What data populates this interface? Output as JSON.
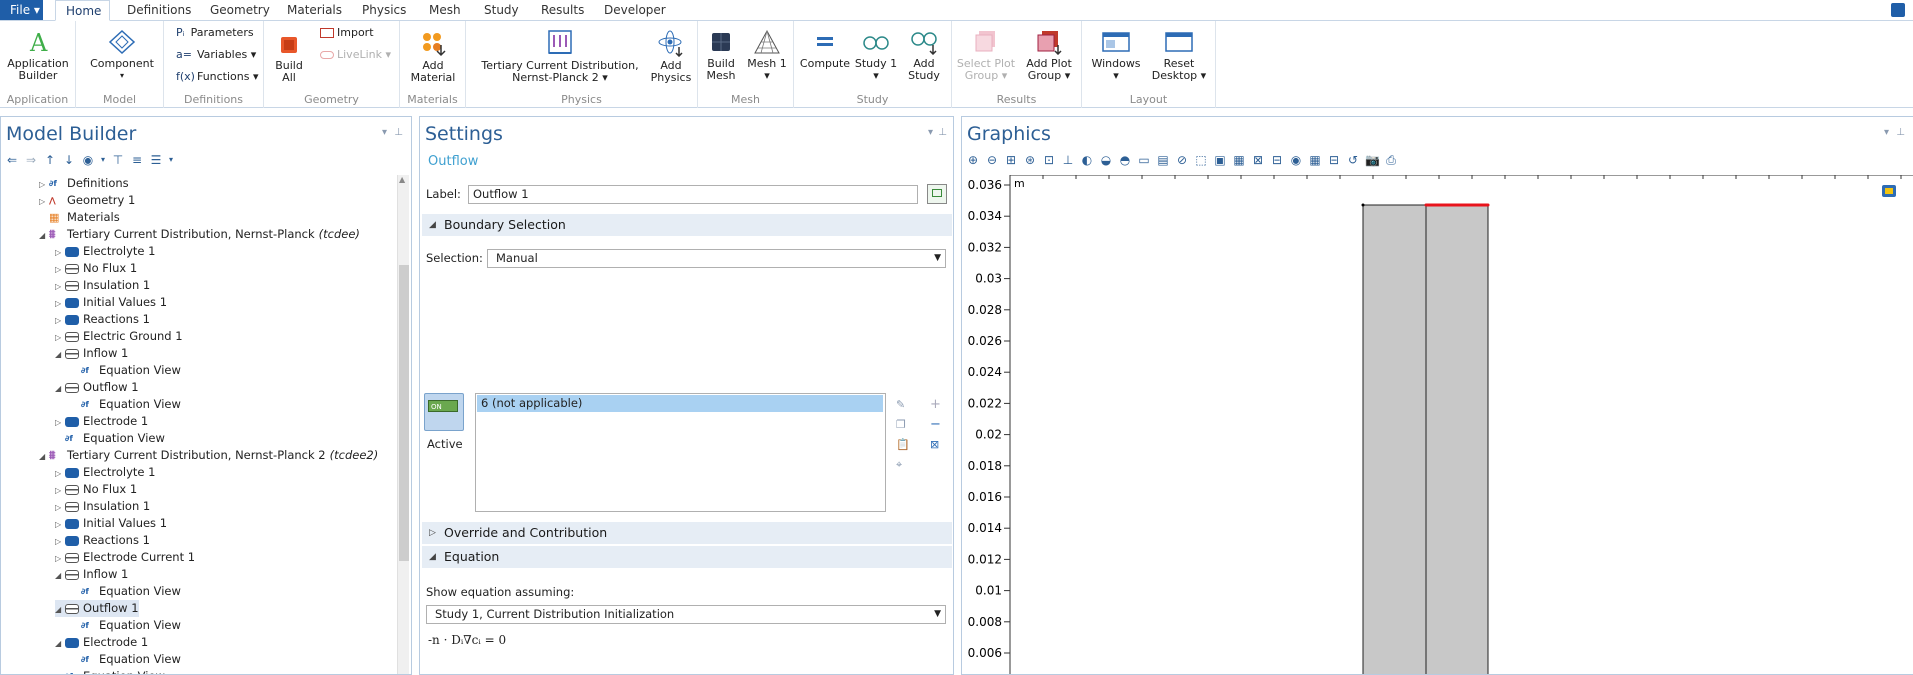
{
  "menubar": {
    "file": "File ▾",
    "tabs": [
      "Home",
      "Definitions",
      "Geometry",
      "Materials",
      "Physics",
      "Mesh",
      "Study",
      "Results",
      "Developer"
    ],
    "active_tab": "Home"
  },
  "ribbon": {
    "groups": {
      "application": "Application",
      "model": "Model",
      "definitions": "Definitions",
      "geometry": "Geometry",
      "materials": "Materials",
      "physics": "Physics",
      "mesh": "Mesh",
      "study": "Study",
      "results": "Results",
      "layout": "Layout"
    },
    "buttons": {
      "app_builder": "Application Builder",
      "component": "Component",
      "parameters": "Parameters",
      "variables": "Variables ▾",
      "functions": "Functions ▾",
      "build_all": "Build All",
      "import": "Import",
      "livelink": "LiveLink ▾",
      "add_material": "Add Material",
      "physics_iface": "Tertiary Current Distribution, Nernst-Planck 2 ▾",
      "add_physics": "Add Physics",
      "build_mesh": "Build Mesh",
      "mesh1": "Mesh 1 ▾",
      "compute": "Compute",
      "study1": "Study 1 ▾",
      "add_study": "Add Study",
      "select_plot_group": "Select Plot Group ▾",
      "add_plot_group": "Add Plot Group ▾",
      "windows": "Windows ▾",
      "reset_desktop": "Reset Desktop ▾"
    },
    "icons": {
      "parameters": "Pᵢ",
      "variables": "a=",
      "functions": "f(x)"
    }
  },
  "model_builder": {
    "title": "Model Builder",
    "tree": [
      {
        "label": "Definitions",
        "indent": 1,
        "arrow": "▷",
        "icon": "eq",
        "bold": false
      },
      {
        "label": "Geometry 1",
        "indent": 1,
        "arrow": "▷",
        "icon": "geom"
      },
      {
        "label": "Materials",
        "indent": 1,
        "arrow": "",
        "icon": "mat"
      },
      {
        "label": "Tertiary Current Distribution, Nernst-Planck",
        "suffix": "(tcdee)",
        "indent": 1,
        "arrow": "◢",
        "icon": "phys"
      },
      {
        "label": "Electrolyte 1",
        "indent": 2,
        "arrow": "▷",
        "icon": "blue"
      },
      {
        "label": "No Flux 1",
        "indent": 2,
        "arrow": "▷",
        "icon": "bound"
      },
      {
        "label": "Insulation 1",
        "indent": 2,
        "arrow": "▷",
        "icon": "bound"
      },
      {
        "label": "Initial Values 1",
        "indent": 2,
        "arrow": "▷",
        "icon": "blue"
      },
      {
        "label": "Reactions 1",
        "indent": 2,
        "arrow": "▷",
        "icon": "blue"
      },
      {
        "label": "Electric Ground 1",
        "indent": 2,
        "arrow": "▷",
        "icon": "bound"
      },
      {
        "label": "Inflow 1",
        "indent": 2,
        "arrow": "◢",
        "icon": "bound"
      },
      {
        "label": "Equation View",
        "indent": 3,
        "arrow": "",
        "icon": "eq"
      },
      {
        "label": "Outflow 1",
        "indent": 2,
        "arrow": "◢",
        "icon": "bound"
      },
      {
        "label": "Equation View",
        "indent": 3,
        "arrow": "",
        "icon": "eq"
      },
      {
        "label": "Electrode 1",
        "indent": 2,
        "arrow": "▷",
        "icon": "blue"
      },
      {
        "label": "Equation View",
        "indent": 2,
        "arrow": "",
        "icon": "eq"
      },
      {
        "label": "Tertiary Current Distribution, Nernst-Planck 2",
        "suffix": "(tcdee2)",
        "indent": 1,
        "arrow": "◢",
        "icon": "phys"
      },
      {
        "label": "Electrolyte 1",
        "indent": 2,
        "arrow": "▷",
        "icon": "blue"
      },
      {
        "label": "No Flux 1",
        "indent": 2,
        "arrow": "▷",
        "icon": "bound"
      },
      {
        "label": "Insulation 1",
        "indent": 2,
        "arrow": "▷",
        "icon": "bound"
      },
      {
        "label": "Initial Values 1",
        "indent": 2,
        "arrow": "▷",
        "icon": "blue"
      },
      {
        "label": "Reactions 1",
        "indent": 2,
        "arrow": "▷",
        "icon": "blue"
      },
      {
        "label": "Electrode Current 1",
        "indent": 2,
        "arrow": "▷",
        "icon": "bound"
      },
      {
        "label": "Inflow 1",
        "indent": 2,
        "arrow": "◢",
        "icon": "bound"
      },
      {
        "label": "Equation View",
        "indent": 3,
        "arrow": "",
        "icon": "eq"
      },
      {
        "label": "Outflow 1",
        "indent": 2,
        "arrow": "◢",
        "icon": "bound",
        "selected": true
      },
      {
        "label": "Equation View",
        "indent": 3,
        "arrow": "",
        "icon": "eq"
      },
      {
        "label": "Electrode 1",
        "indent": 2,
        "arrow": "◢",
        "icon": "blue"
      },
      {
        "label": "Equation View",
        "indent": 3,
        "arrow": "",
        "icon": "eq"
      },
      {
        "label": "Equation View",
        "indent": 2,
        "arrow": "",
        "icon": "eq"
      }
    ]
  },
  "settings": {
    "title": "Settings",
    "subtitle": "Outflow",
    "label_caption": "Label:",
    "label_value": "Outflow 1",
    "boundary_section": "Boundary Selection",
    "selection_caption": "Selection:",
    "selection_value": "Manual",
    "list_item": "6 (not applicable)",
    "active_caption": "Active",
    "active_badge": "ON",
    "override_section": "Override and Contribution",
    "equation_section": "Equation",
    "show_eq_caption": "Show equation assuming:",
    "show_eq_value": "Study 1, Current Distribution Initialization",
    "equation": "-n · Dᵢ∇cᵢ = 0"
  },
  "graphics": {
    "title": "Graphics",
    "unit": "m",
    "y_ticks": [
      "0.036",
      "0.034",
      "0.032",
      "0.03",
      "0.028",
      "0.026",
      "0.024",
      "0.022",
      "0.02",
      "0.018",
      "0.016",
      "0.014",
      "0.012",
      "0.01",
      "0.008",
      "0.006"
    ],
    "colors": {
      "domain": "#c8c8c8",
      "highlight": "#e8141c"
    }
  }
}
